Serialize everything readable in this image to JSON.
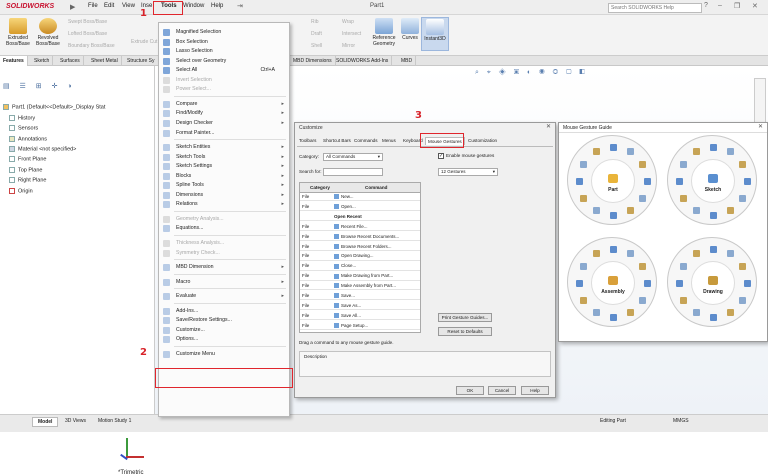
{
  "app": {
    "logo": "SOLIDWORKS",
    "title": "Part1",
    "search_placeholder": "Search SOLIDWORKS Help"
  },
  "menu": [
    "File",
    "Edit",
    "View",
    "Inse",
    "Tools",
    "Window",
    "Help"
  ],
  "ribbon": {
    "extruded": "Extruded Boss/Base",
    "revolved": "Revolved Boss/Base",
    "swept": "Swept Boss/Base",
    "lofted": "Lofted Boss/Base",
    "boundary": "Boundary Boss/Base",
    "extruded_cut": "Extrude Cut",
    "rib": "Rib",
    "wrap": "Wrap",
    "draft": "Draft",
    "intersect": "Intersect",
    "shell": "Shell",
    "mirror": "Mirror",
    "refgeo": "Reference Geometry",
    "curves": "Curves",
    "instant3d": "Instant3D"
  },
  "cm_tabs": [
    "Features",
    "Sketch",
    "Surfaces",
    "Sheet Metal",
    "Structure Sy"
  ],
  "cm_tabs_right": [
    "MBD Dimensions",
    "SOLIDWORKS Add-Ins",
    "MBD"
  ],
  "tree": [
    "Part1 (Default<<Default>_Display Stat",
    "History",
    "Sensors",
    "Annotations",
    "Material <not specified>",
    "Front Plane",
    "Top Plane",
    "Right Plane",
    "Origin"
  ],
  "tools_menu": [
    {
      "label": "Magnified Selection",
      "dis": false
    },
    {
      "label": "Box Selection",
      "dis": false
    },
    {
      "label": "Lasso Selection",
      "dis": false
    },
    {
      "label": "Select over Geometry",
      "dis": false
    },
    {
      "label": "Select All",
      "dis": false,
      "shortcut": "Ctrl+A"
    },
    {
      "label": "Invert Selection",
      "dis": true
    },
    {
      "label": "Power Select...",
      "dis": true
    },
    {
      "sep": true
    },
    {
      "label": "Compare",
      "dis": false,
      "sub": true
    },
    {
      "label": "Find/Modify",
      "dis": false,
      "sub": true
    },
    {
      "label": "Design Checker",
      "dis": false,
      "sub": true
    },
    {
      "label": "Format Painter...",
      "dis": false
    },
    {
      "sep": true
    },
    {
      "label": "Sketch Entities",
      "dis": false,
      "sub": true
    },
    {
      "label": "Sketch Tools",
      "dis": false,
      "sub": true
    },
    {
      "label": "Sketch Settings",
      "dis": false,
      "sub": true
    },
    {
      "label": "Blocks",
      "dis": false,
      "sub": true
    },
    {
      "label": "Spline Tools",
      "dis": false,
      "sub": true
    },
    {
      "label": "Dimensions",
      "dis": false,
      "sub": true
    },
    {
      "label": "Relations",
      "dis": false,
      "sub": true
    },
    {
      "sep": true
    },
    {
      "label": "Geometry Analysis...",
      "dis": true
    },
    {
      "label": "Equations...",
      "dis": false
    },
    {
      "sep": true
    },
    {
      "label": "Thickness Analysis...",
      "dis": true
    },
    {
      "label": "Symmetry Check...",
      "dis": true
    },
    {
      "sep": true
    },
    {
      "label": "MBD Dimension",
      "dis": false,
      "sub": true
    },
    {
      "sep": true
    },
    {
      "label": "Macro",
      "dis": false,
      "sub": true
    },
    {
      "sep": true
    },
    {
      "label": "Evaluate",
      "dis": false,
      "sub": true
    },
    {
      "sep": true
    },
    {
      "label": "Add-Ins...",
      "dis": false
    },
    {
      "label": "Save/Restore Settings...",
      "dis": false
    },
    {
      "label": "Customize...",
      "dis": false
    },
    {
      "label": "Options...",
      "dis": false
    },
    {
      "sep": true
    },
    {
      "label": "Customize Menu",
      "dis": false
    }
  ],
  "dialog": {
    "title": "Customize",
    "tabs": [
      "Toolbars",
      "Shortcut Bars",
      "Commands",
      "Menus",
      "Keyboard",
      "Mouse Gestures",
      "Customization"
    ],
    "category_label": "Category:",
    "category_value": "All Commands",
    "search_label": "Search for:",
    "enable_label": "Enable mouse gestures",
    "gestures_value": "12 Gestures",
    "col_category": "Category",
    "col_command": "Command",
    "rows": [
      {
        "c": "File",
        "m": "New...",
        "g": false
      },
      {
        "c": "File",
        "m": "Open...",
        "g": false
      },
      {
        "c": "",
        "m": "Open Recent",
        "g": true
      },
      {
        "c": "File",
        "m": "Recent File...",
        "g": false
      },
      {
        "c": "File",
        "m": "Browse Recent Documents...",
        "g": false
      },
      {
        "c": "File",
        "m": "Browse Recent Folders...",
        "g": false
      },
      {
        "c": "File",
        "m": "Open Drawing...",
        "g": false
      },
      {
        "c": "File",
        "m": "Close...",
        "g": false
      },
      {
        "c": "File",
        "m": "Make Drawing from Part...",
        "g": false
      },
      {
        "c": "File",
        "m": "Make Assembly from Part...",
        "g": false
      },
      {
        "c": "File",
        "m": "Save...",
        "g": false
      },
      {
        "c": "File",
        "m": "Save As...",
        "g": false
      },
      {
        "c": "File",
        "m": "Save All...",
        "g": false
      },
      {
        "c": "File",
        "m": "Page Setup...",
        "g": false
      }
    ],
    "print_btn": "Print Gesture Guides...",
    "reset_btn": "Reset to Defaults",
    "drag_text": "Drag a command to any mouse gesture guide.",
    "desc_label": "Description",
    "ok": "OK",
    "cancel": "Cancel",
    "help": "Help"
  },
  "guide": {
    "title": "Mouse Gesture Guide",
    "wheels": [
      "Part",
      "Sketch",
      "Assembly",
      "Drawing"
    ]
  },
  "view_label": "*Trimetric",
  "status_tabs": [
    "Model",
    "3D Views",
    "Motion Study 1"
  ],
  "status_right": [
    "Editing Part",
    "MMGS"
  ],
  "annotations": [
    "1",
    "2",
    "3"
  ]
}
